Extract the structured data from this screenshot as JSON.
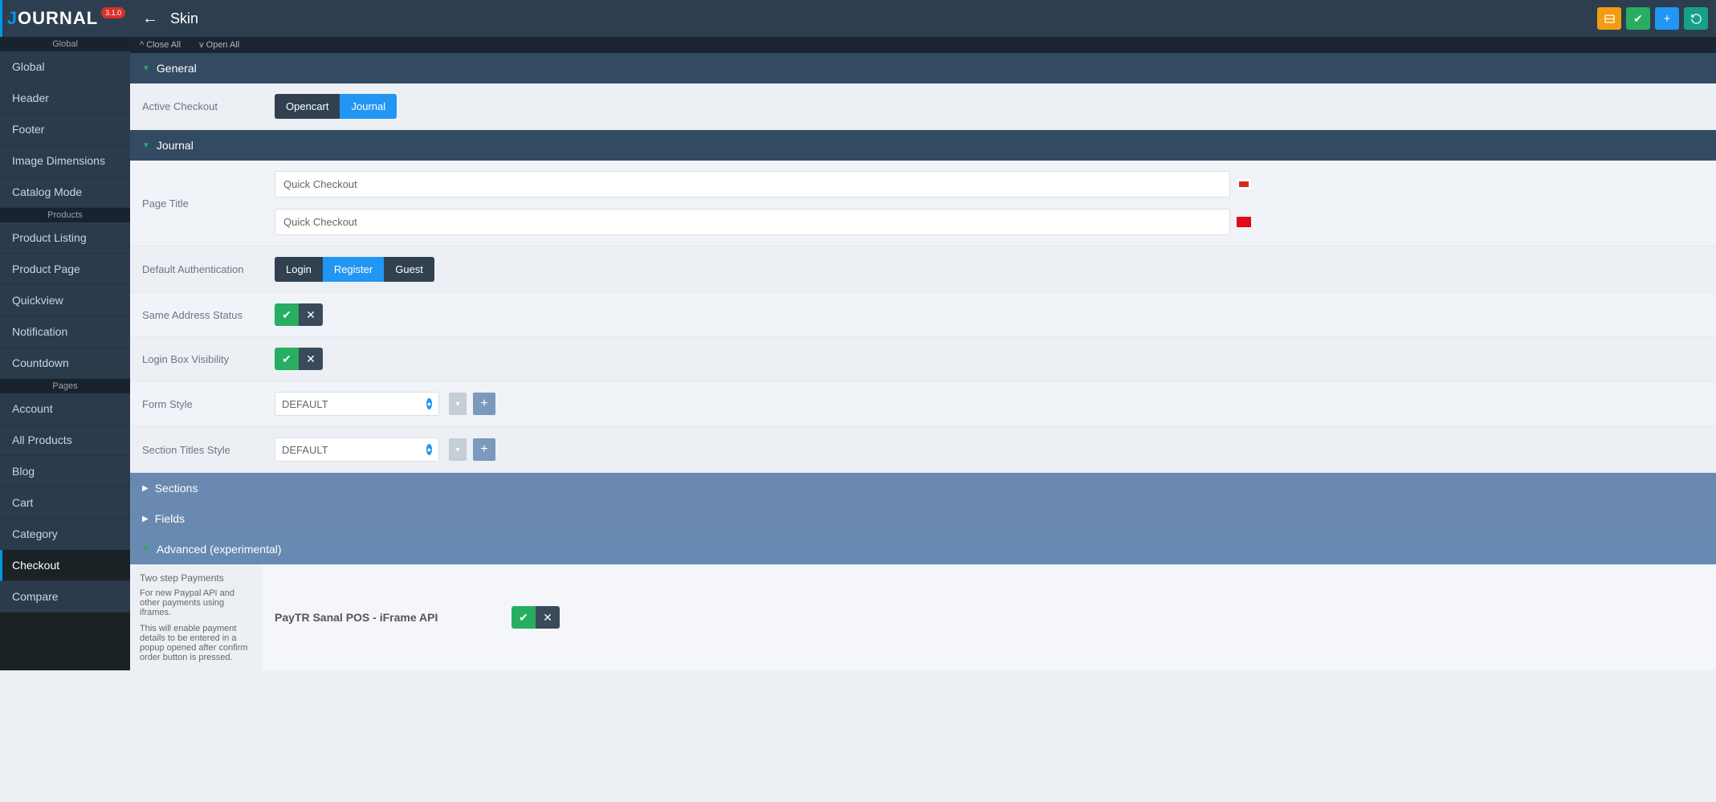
{
  "header": {
    "logo": "JOURNAL",
    "version": "3.1.0",
    "page_title": "Skin"
  },
  "top_actions": {
    "screenshot": "⬚",
    "save": "✔",
    "add": "+",
    "history": "↻"
  },
  "sidebar": {
    "sections": [
      {
        "header": "Global",
        "items": [
          "Global",
          "Header",
          "Footer",
          "Image Dimensions",
          "Catalog Mode"
        ]
      },
      {
        "header": "Products",
        "items": [
          "Product Listing",
          "Product Page",
          "Quickview",
          "Notification",
          "Countdown"
        ]
      },
      {
        "header": "Pages",
        "items": [
          "Account",
          "All Products",
          "Blog",
          "Cart",
          "Category",
          "Checkout",
          "Compare"
        ]
      }
    ],
    "active": "Checkout"
  },
  "accordion": {
    "close_all": "Close All",
    "open_all": "Open All"
  },
  "sections": {
    "general": "General",
    "journal": "Journal",
    "sections": "Sections",
    "fields": "Fields",
    "advanced": "Advanced (experimental)"
  },
  "rows": {
    "active_checkout": {
      "label": "Active Checkout",
      "options": [
        "Opencart",
        "Journal"
      ],
      "active": "Journal"
    },
    "page_title": {
      "label": "Page Title",
      "values": [
        "Quick Checkout",
        "Quick Checkout"
      ]
    },
    "default_auth": {
      "label": "Default Authentication",
      "options": [
        "Login",
        "Register",
        "Guest"
      ],
      "active": "Register"
    },
    "same_address": {
      "label": "Same Address Status"
    },
    "login_box": {
      "label": "Login Box Visibility"
    },
    "form_style": {
      "label": "Form Style",
      "value": "DEFAULT"
    },
    "section_titles": {
      "label": "Section Titles Style",
      "value": "DEFAULT"
    }
  },
  "advanced": {
    "side_title": "Two step Payments",
    "side_text1": "For new Paypal API and other payments using iframes.",
    "side_text2": "This will enable payment details to be entered in a popup opened after confirm order button is pressed.",
    "payment_label": "PayTR Sanal POS - iFrame API"
  }
}
